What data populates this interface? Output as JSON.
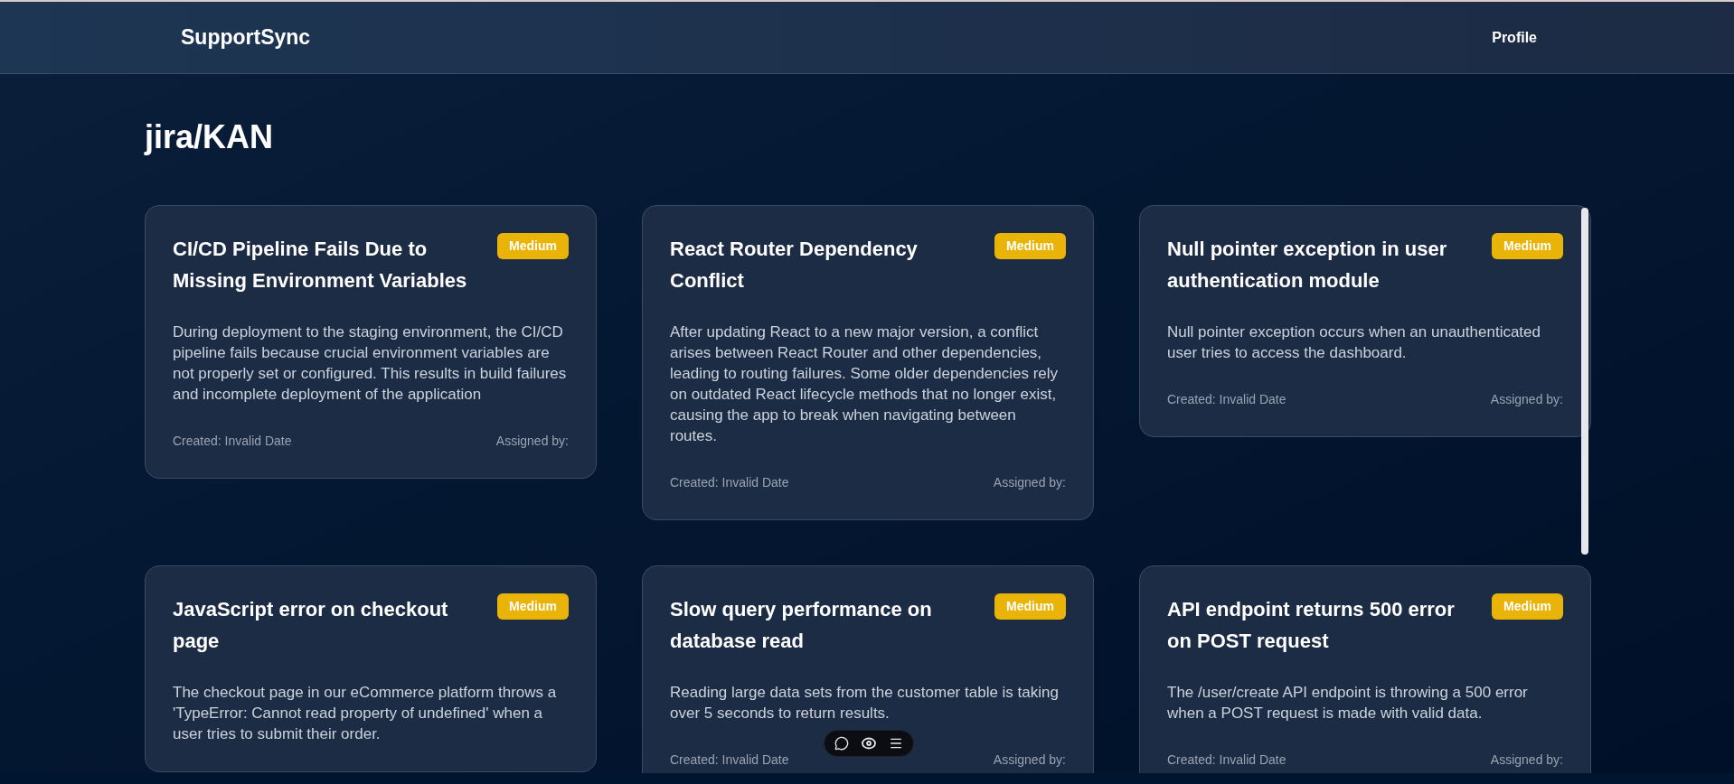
{
  "header": {
    "brand": "SupportSync",
    "nav": [
      "Profile"
    ]
  },
  "page_title": "jira/KAN",
  "tickets": [
    {
      "title": "CI/CD Pipeline Fails Due to Missing Environment Variables",
      "priority": "Medium",
      "description": "During deployment to the staging environment, the CI/CD pipeline fails because crucial environment variables are not properly set or configured. This results in build failures and incomplete deployment of the application",
      "created": "Created: Invalid Date",
      "assigned": "Assigned by:"
    },
    {
      "title": "React Router Dependency Conflict",
      "priority": "Medium",
      "description": "After updating React to a new major version, a conflict arises between React Router and other dependencies, leading to routing failures. Some older dependencies rely on outdated React lifecycle methods that no longer exist, causing the app to break when navigating between routes.",
      "created": "Created: Invalid Date",
      "assigned": "Assigned by:"
    },
    {
      "title": "Null pointer exception in user authentication module",
      "priority": "Medium",
      "description": "Null pointer exception occurs when an unauthenticated user tries to access the dashboard.",
      "created": "Created: Invalid Date",
      "assigned": "Assigned by:"
    },
    {
      "title": "JavaScript error on checkout page",
      "priority": "Medium",
      "description": "The checkout page in our eCommerce platform throws a 'TypeError: Cannot read property of undefined' when a user tries to submit their order."
    },
    {
      "title": "Slow query performance on database read",
      "priority": "Medium",
      "description": "Reading large data sets from the customer table is taking over 5 seconds to return results.",
      "created": "Created: Invalid Date",
      "assigned": "Assigned by:"
    },
    {
      "title": "API endpoint returns 500 error on POST request",
      "priority": "Medium",
      "description": "The /user/create API endpoint is throwing a 500 error when a POST request is made with valid data.",
      "created": "Created: Invalid Date",
      "assigned": "Assigned by:"
    }
  ]
}
